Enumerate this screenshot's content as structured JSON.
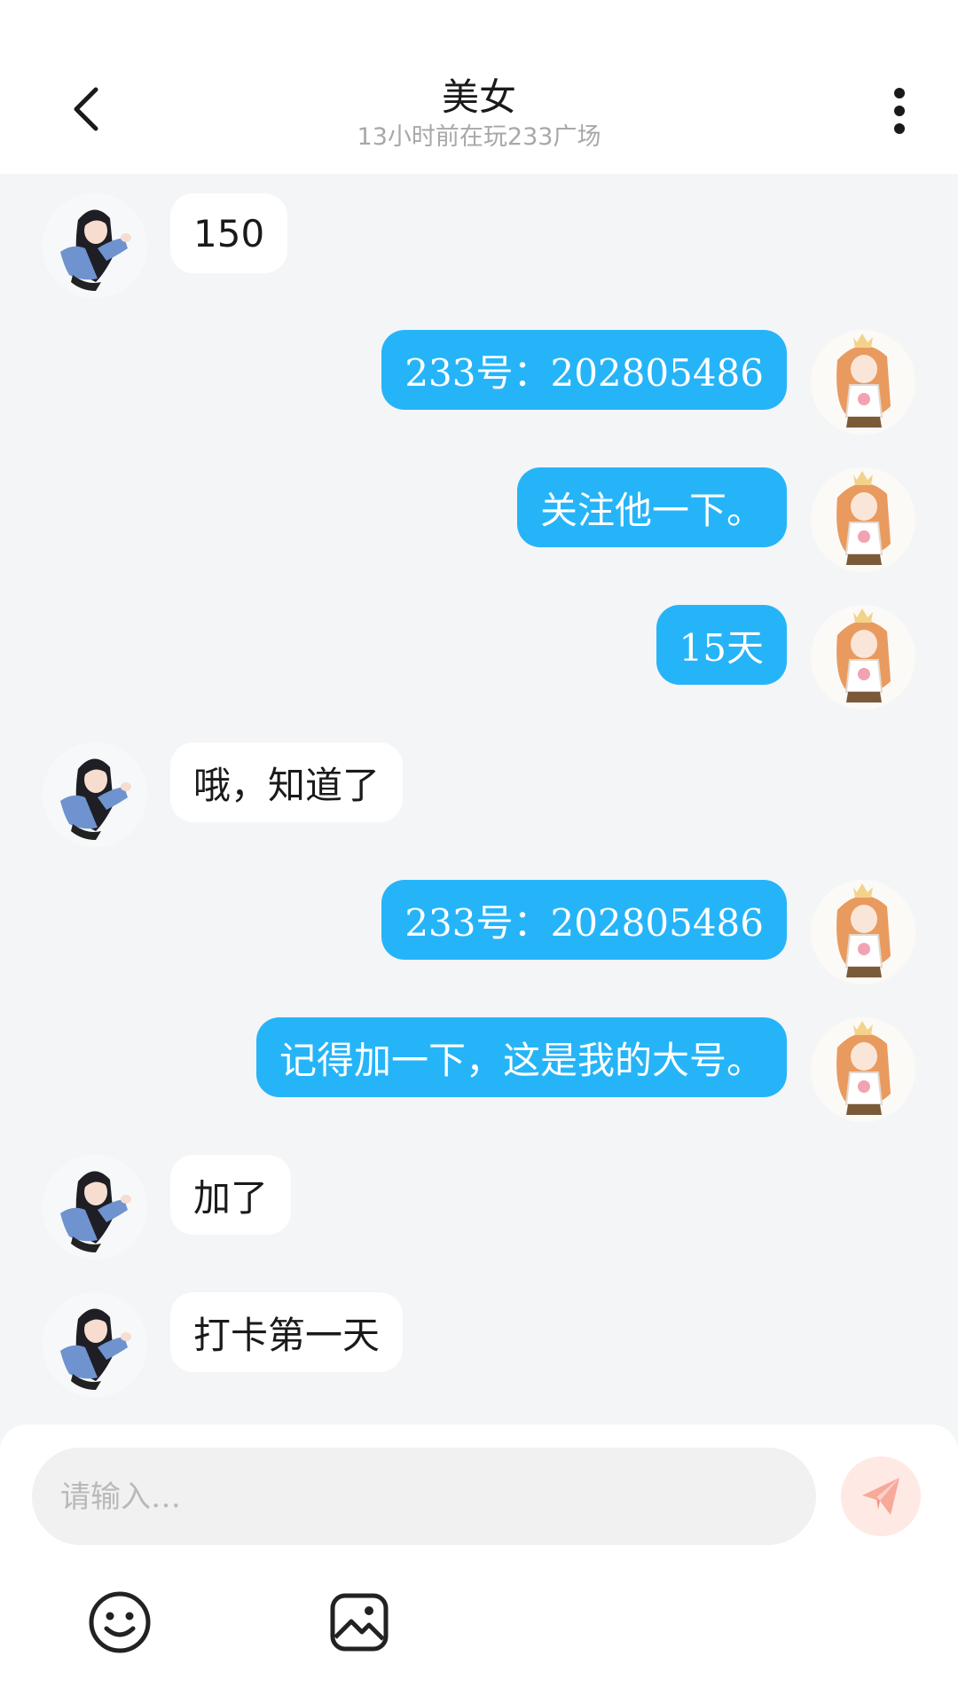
{
  "header": {
    "title": "美女",
    "subtitle": "13小时前在玩233广场"
  },
  "messages": [
    {
      "direction": "in",
      "text": "150"
    },
    {
      "direction": "out",
      "text": "233号：202805486"
    },
    {
      "direction": "out",
      "text": "关注他一下。"
    },
    {
      "direction": "out",
      "text": "15天"
    },
    {
      "direction": "in",
      "text": "哦，知道了"
    },
    {
      "direction": "out",
      "text": "233号：202805486"
    },
    {
      "direction": "out",
      "text": "记得加一下，这是我的大号。"
    },
    {
      "direction": "in",
      "text": "加了"
    },
    {
      "direction": "in",
      "text": "打卡第一天"
    }
  ],
  "composer": {
    "placeholder": "请输入…"
  },
  "colors": {
    "outgoing_bubble": "#26b4f8",
    "incoming_bubble": "#ffffff",
    "chat_background": "#f3f5f7",
    "send_button_bg": "#ffe9e4",
    "send_icon": "#f7a99a"
  },
  "icons": {
    "back": "chevron-left-icon",
    "more": "vertical-dots-icon",
    "send": "paper-plane-icon",
    "emoji": "smiley-icon",
    "image": "image-icon"
  }
}
